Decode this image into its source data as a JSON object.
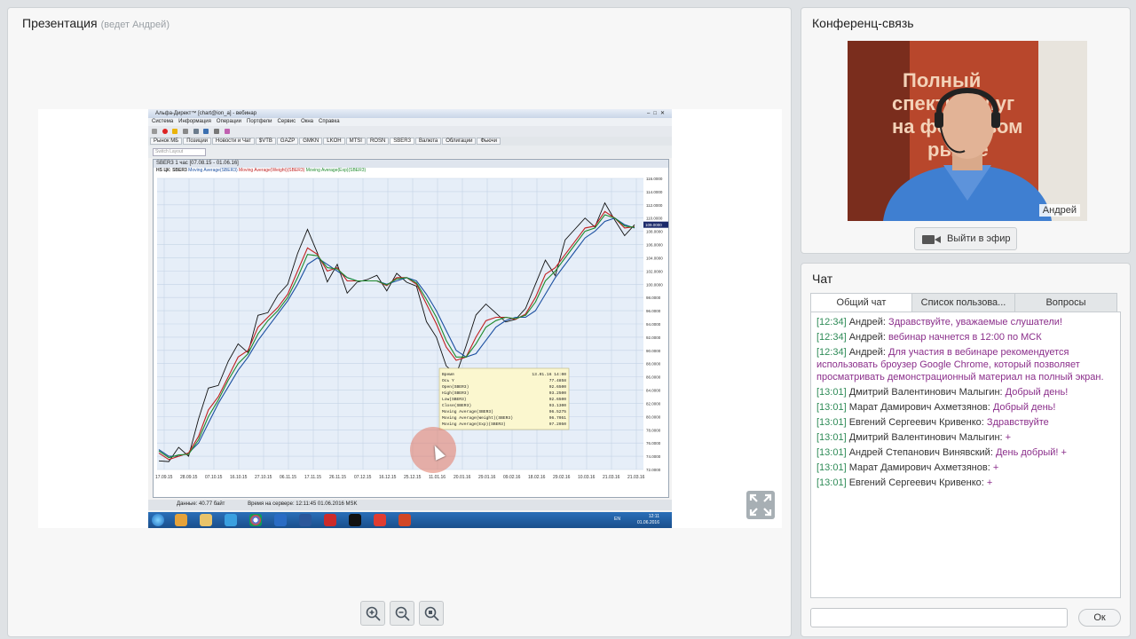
{
  "presentation": {
    "title": "Презентация",
    "subtitle": "(ведет Андрей)",
    "screenshot": {
      "window_title": "Альфа-Директ™ [chart@ion_a] - вебинар",
      "menu": [
        "Система",
        "Информация",
        "Операции",
        "Портфели",
        "Сервис",
        "Окна",
        "Справка"
      ],
      "tabs": [
        "Рынок МБ",
        "Позиции",
        "Новости и Чат",
        "$VTB",
        "GAZP",
        "GMKN",
        "LKOH",
        "MTSI",
        "ROSN",
        "SBER3",
        "Валюта",
        "Облигации",
        "Фьючи"
      ],
      "active_tab": "SBER3",
      "search_placeholder": "Switch Layout",
      "chart_header": "SBER3 1 час [07.08.15 - 01.06.16]",
      "legend": {
        "prefix": "HS ЦК: SBER3",
        "sma": "Moving Average(SBER3)",
        "wma": "Moving Average(Weight)(SBER3)",
        "ema": "Moving Average(Exp)(SBER3)"
      },
      "status": {
        "data": "Данные: 40.77 байт",
        "server_time": "Время на сервере: 12:11:45 01.06.2016 MSK"
      },
      "clock": {
        "time": "12:11",
        "date": "01.06.2016"
      },
      "tray_lang": "EN"
    }
  },
  "chart_data": {
    "type": "line",
    "title": "SBER3 1 час [07.08.15 - 01.06.16]",
    "x_tick_labels": [
      "17.09.15",
      "28.09.15",
      "07.10.15",
      "16.10.15",
      "27.10.15",
      "06.11.15",
      "17.11.15",
      "26.11.15",
      "07.12.15",
      "16.12.15",
      "25.12.15",
      "11.01.16",
      "20.01.16",
      "29.01.16",
      "09.02.16",
      "18.02.16",
      "29.02.16",
      "10.03.16",
      "21.03.16",
      "21.03.16"
    ],
    "y_tick_labels": [
      "116.0000",
      "114.0000",
      "112.0000",
      "110.0000",
      "108.0000",
      "106.0000",
      "104.0000",
      "102.0000",
      "100.0000",
      "98.0000",
      "96.0000",
      "94.0000",
      "92.0000",
      "90.0000",
      "88.0000",
      "86.0000",
      "84.0000",
      "82.0000",
      "80.0000",
      "78.0000",
      "76.0000",
      "74.0000",
      "72.0000"
    ],
    "last_price_label": "109.0000",
    "ylim": [
      72,
      116
    ],
    "grid": true,
    "series": [
      {
        "name": "SBER3",
        "color": "#111111",
        "values": [
          74,
          72.5,
          75,
          74,
          80,
          85,
          84,
          88,
          91,
          90,
          96,
          95,
          98,
          100,
          105,
          109,
          104,
          100,
          103,
          99,
          101,
          100,
          101,
          99,
          102,
          101,
          99,
          94,
          92,
          88,
          87,
          90,
          95,
          97,
          96,
          95,
          94,
          96,
          100,
          104,
          102,
          106,
          108,
          110,
          109,
          113,
          109,
          107,
          109
        ]
      },
      {
        "name": "Moving Average(SBER3)",
        "color": "#1b4fa0",
        "values": [
          75,
          74,
          74,
          74.5,
          76,
          79,
          82,
          84.5,
          87,
          89,
          91.5,
          93.5,
          95.5,
          97.5,
          100,
          103,
          104,
          103,
          102,
          101,
          100.5,
          100.5,
          100.5,
          100,
          100.5,
          101,
          100.5,
          98.5,
          96,
          93,
          90,
          89,
          89.5,
          91.5,
          93.5,
          94.5,
          95,
          95,
          96,
          98.5,
          101,
          103,
          105,
          107,
          108,
          109.5,
          110,
          109,
          108.5
        ]
      },
      {
        "name": "Moving Average(Weight)(SBER3)",
        "color": "#c02020",
        "values": [
          74.5,
          73.5,
          74,
          74.5,
          77,
          81,
          83,
          86,
          89,
          90,
          93.5,
          95,
          96.5,
          98.5,
          102,
          105.5,
          104.5,
          102,
          102.5,
          100.5,
          100.5,
          100.5,
          100.5,
          99.8,
          101,
          101,
          100,
          97,
          94,
          90.5,
          88.5,
          89,
          92,
          94.5,
          95,
          95,
          94.7,
          95.5,
          98,
          101.5,
          102.5,
          104.5,
          106.5,
          108.5,
          108.8,
          111,
          110,
          108.5,
          108.7
        ]
      },
      {
        "name": "Moving Average(Exp)(SBER3)",
        "color": "#1d8a2c",
        "values": [
          74.8,
          73.8,
          74.2,
          74.3,
          76.5,
          80,
          82.5,
          85.5,
          88,
          89.5,
          92.5,
          94.5,
          96,
          98,
          101,
          104.5,
          104.3,
          102.5,
          102.3,
          101,
          100.5,
          100.5,
          100.5,
          99.9,
          100.8,
          101,
          100.2,
          97.7,
          95,
          91.5,
          89,
          89,
          91,
          93.5,
          94.5,
          95,
          94.8,
          95.3,
          97.3,
          100.5,
          102,
          104,
          106,
          108,
          108.5,
          110.5,
          110,
          108.8,
          108.6
        ]
      }
    ],
    "tooltip": {
      "rows": [
        [
          "Время",
          "13.01.16 14:00"
        ],
        [
          "Ось Y",
          "77.4858"
        ],
        [
          "Open(SBER3)",
          "92.6500"
        ],
        [
          "High(SBER3)",
          "93.2500"
        ],
        [
          "Low(SBER3)",
          "92.6500"
        ],
        [
          "Close(SBER3)",
          "93.1300"
        ],
        [
          "Moving Average(SBER3)",
          "96.5275"
        ],
        [
          "Moving Average(Weight)(SBER3)",
          "96.7051"
        ],
        [
          "Moving Average(Exp)(SBER3)",
          "97.2050"
        ]
      ]
    }
  },
  "conference": {
    "title": "Конференц-связь",
    "presenter_name": "Андрей",
    "banner_text": "Полный спектр услуг на фондовом рынке",
    "on_air_label": "Выйти в эфир"
  },
  "chat": {
    "title": "Чат",
    "tabs": [
      "Общий чат",
      "Список пользова...",
      "Вопросы"
    ],
    "messages": [
      {
        "time": "[12:34]",
        "author": "Андрей:",
        "text": "Здравствуйте, уважаемые слушатели!"
      },
      {
        "time": "[12:34]",
        "author": "Андрей:",
        "text": "вебинар начнется в 12:00 по МСК"
      },
      {
        "time": "[12:34]",
        "author": "Андрей:",
        "text": "Для участия в вебинаре рекомендуется использовать броузер Google Chrome, который позволяет просматривать демонстрационный материал на полный экран."
      },
      {
        "time": "[13:01]",
        "author": "Дмитрий Валентинович Малыгин:",
        "text": "Добрый день!"
      },
      {
        "time": "[13:01]",
        "author": "Марат Дамирович Ахметзянов:",
        "text": "Добрый день!"
      },
      {
        "time": "[13:01]",
        "author": "Евгений Сергеевич Кривенко:",
        "text": "Здравствуйте"
      },
      {
        "time": "[13:01]",
        "author": "Дмитрий Валентинович Малыгин:",
        "text": "+"
      },
      {
        "time": "[13:01]",
        "author": "Андрей Степанович Винявский:",
        "text": "День добрый! +"
      },
      {
        "time": "[13:01]",
        "author": "Марат Дамирович Ахметзянов:",
        "text": "+"
      },
      {
        "time": "[13:01]",
        "author": "Евгений Сергеевич Кривенко:",
        "text": "+"
      }
    ],
    "input_value": "",
    "send_label": "Ок"
  }
}
